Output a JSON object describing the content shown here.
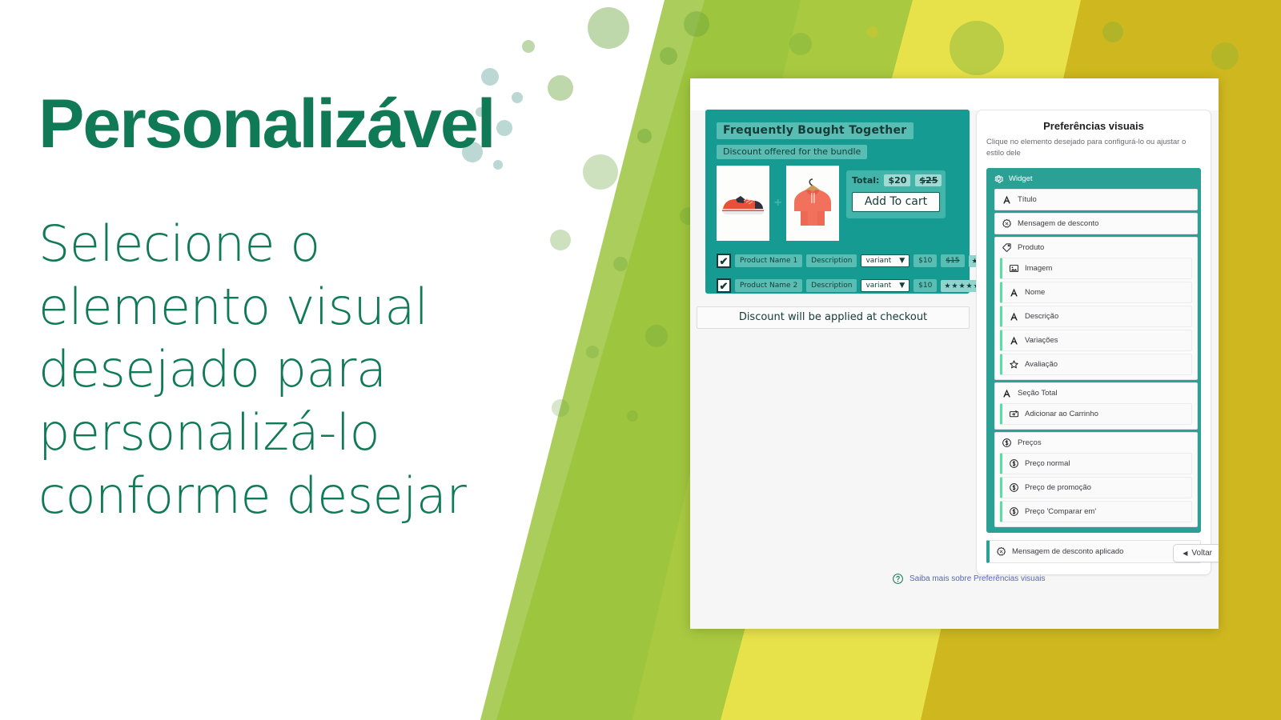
{
  "marketing": {
    "headline": "Personalizável",
    "subcopy": "Selecione o elemento visual desejado para personalizá-lo conforme desejar",
    "headline_color": "#0f7a55",
    "subcopy_color": "#0f7a55"
  },
  "theme": {
    "teal": "#159b91",
    "teal_panel": "#2ba095",
    "accent_green": "#4fe3a0",
    "gold": "#cfb81f",
    "yellow": "#e8e24a",
    "olive": "#a8c93f",
    "link_blue": "#5a63c4"
  },
  "widget_preview": {
    "title": "Frequently Bought Together",
    "discount_message": "Discount offered for the bundle",
    "plus_sign": "+",
    "images": [
      {
        "name": "shoe-image",
        "alt": "running shoe"
      },
      {
        "name": "hoodie-image",
        "alt": "orange hoodie"
      }
    ],
    "total": {
      "label": "Total:",
      "price": "$20",
      "compare_price": "$25",
      "add_to_cart": "Add To cart"
    },
    "products": [
      {
        "checked": "✔",
        "name": "Product Name 1",
        "description": "Description",
        "variant": "variant",
        "variant_caret": "▼",
        "price": "$10",
        "compare_price": "$15",
        "rating": "★★★★★"
      },
      {
        "checked": "✔",
        "name": "Product Name 2",
        "description": "Description",
        "variant": "variant",
        "variant_caret": "▼",
        "price": "$10",
        "compare_price": "",
        "rating": "★★★★★"
      }
    ],
    "checkout_note": "Discount will be applied at checkout"
  },
  "preferences_panel": {
    "title": "Preferências visuais",
    "subtitle": "Clique no elemento desejado para configurá-lo ou ajustar o estilo dele",
    "tree": {
      "root_label": "Widget",
      "root_icon": "gear-icon",
      "groups": [
        {
          "label": "Título",
          "icon": "text-icon",
          "children": []
        },
        {
          "label": "Mensagem de desconto",
          "icon": "discount-badge-icon",
          "children": []
        },
        {
          "label": "Produto",
          "icon": "tag-icon",
          "children": [
            {
              "label": "Imagem",
              "icon": "image-icon"
            },
            {
              "label": "Nome",
              "icon": "text-icon"
            },
            {
              "label": "Descrição",
              "icon": "text-icon"
            },
            {
              "label": "Variações",
              "icon": "text-icon"
            },
            {
              "label": "Avaliação",
              "icon": "star-icon"
            }
          ]
        },
        {
          "label": "Seção Total",
          "icon": "text-icon",
          "children": [
            {
              "label": "Adicionar ao Carrinho",
              "icon": "cart-button-icon"
            }
          ]
        },
        {
          "label": "Preços",
          "icon": "dollar-icon",
          "children": [
            {
              "label": "Preço normal",
              "icon": "dollar-icon"
            },
            {
              "label": "Preço de promoção",
              "icon": "dollar-icon"
            },
            {
              "label": "Preço 'Comparar em'",
              "icon": "dollar-icon"
            }
          ]
        }
      ],
      "footer": {
        "label": "Mensagem de desconto aplicado",
        "icon": "discount-badge-icon"
      }
    },
    "back_button": {
      "label": "Voltar",
      "icon": "caret-left-icon"
    },
    "help_link": {
      "label": "Saiba mais sobre Preferências visuais",
      "icon": "question-circle-icon"
    }
  }
}
